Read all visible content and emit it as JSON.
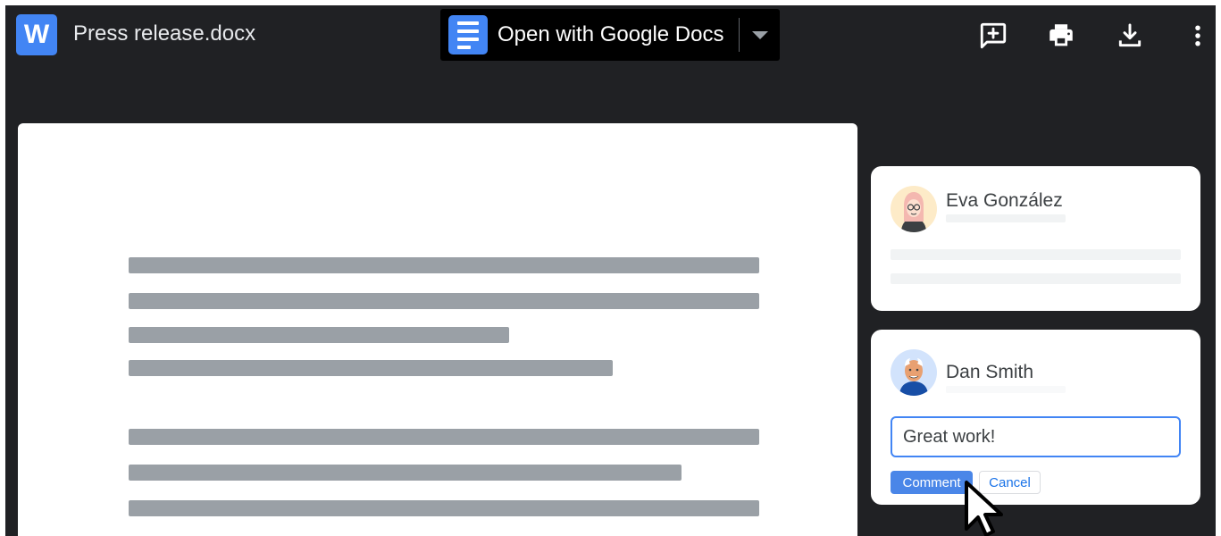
{
  "header": {
    "app_icon_letter": "W",
    "file_title": "Press release.docx",
    "open_with_label": "Open with Google Docs",
    "icons": [
      "add-comment-icon",
      "print-icon",
      "download-icon",
      "more-vert-icon"
    ]
  },
  "comments": [
    {
      "author": "Eva González",
      "avatar": "eva-avatar"
    },
    {
      "author": "Dan Smith",
      "avatar": "dan-avatar",
      "input_value": "Great work!",
      "comment_button": "Comment",
      "cancel_button": "Cancel"
    }
  ],
  "colors": {
    "background": "#202124",
    "accent": "#4285f4",
    "button_blue": "#4a86e8",
    "placeholder_line": "#9aa0a6"
  }
}
